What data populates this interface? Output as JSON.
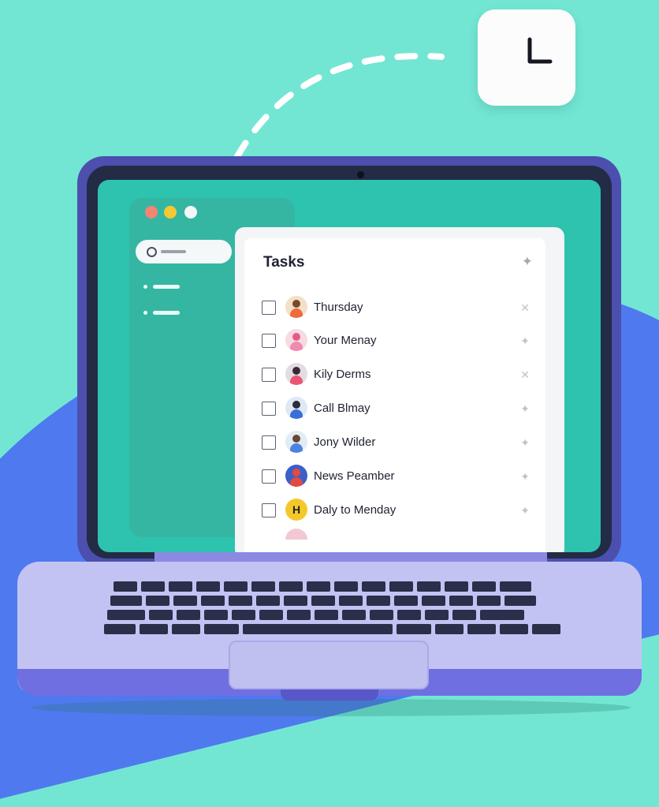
{
  "colors": {
    "background": "#72e6d3",
    "blob": "#4f79ee",
    "screen": "#2dc3ae",
    "laptop_body": "#c3c3f3"
  },
  "clock_tile": {
    "icon": "clock-icon"
  },
  "window_controls": [
    "red",
    "yellow",
    "white"
  ],
  "sidebar": {
    "search_icon": "search-icon",
    "items": [
      {
        "icon": "bullet-icon"
      },
      {
        "icon": "bullet-icon"
      }
    ]
  },
  "tasks": {
    "title": "Tasks",
    "header_icon": "pin-icon",
    "items": [
      {
        "label": "Thursday",
        "avatar": "person-orange"
      },
      {
        "label": "Your Menay",
        "avatar": "person-pink"
      },
      {
        "label": "Kily Derms",
        "avatar": "person-dark"
      },
      {
        "label": "Call Blmay",
        "avatar": "person-blue"
      },
      {
        "label": "Jony Wilder",
        "avatar": "person-blue"
      },
      {
        "label": "News Peamber",
        "avatar": "person-red"
      },
      {
        "label": "Daly to Menday",
        "avatar": "letter-h",
        "avatar_letter": "H"
      }
    ]
  }
}
